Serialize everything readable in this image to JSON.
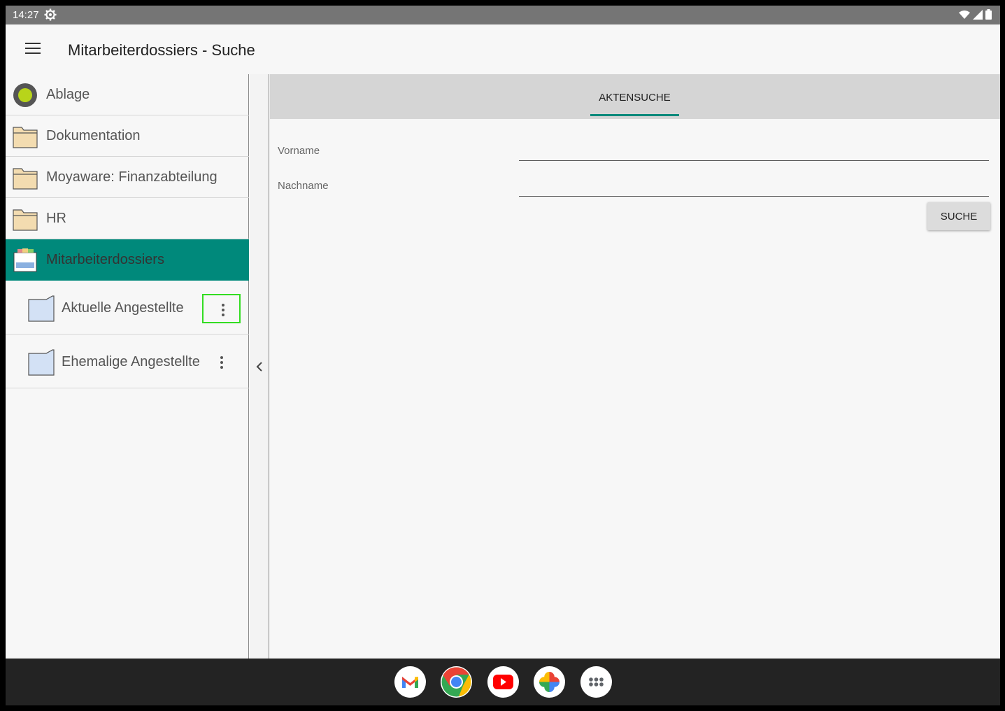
{
  "status_bar": {
    "time": "14:27",
    "icons": [
      "settings-icon",
      "wifi-icon",
      "signal-icon",
      "battery-icon"
    ]
  },
  "app_bar": {
    "title": "Mitarbeiterdossiers - Suche",
    "menu_icon": "menu-icon"
  },
  "nav": {
    "items": [
      {
        "label": "Ablage",
        "icon": "storage-circle-icon"
      },
      {
        "label": "Dokumentation",
        "icon": "folder-icon"
      },
      {
        "label": "Moyaware: Finanzabteilung",
        "icon": "folder-icon"
      },
      {
        "label": "HR",
        "icon": "folder-icon"
      },
      {
        "label": "Mitarbeiterdossiers",
        "icon": "dossier-box-icon",
        "selected": true
      }
    ],
    "sub_items": [
      {
        "label": "Aktuelle Angestellte",
        "icon": "blue-folder-icon",
        "menu_icon": "more-vert-icon",
        "highlighted": true
      },
      {
        "label": "Ehemalige Angestellte",
        "icon": "blue-folder-icon",
        "menu_icon": "more-vert-icon"
      }
    ]
  },
  "search": {
    "tab_label": "AKTENSUCHE",
    "fields": [
      {
        "label": "Vorname",
        "value": ""
      },
      {
        "label": "Nachname",
        "value": ""
      }
    ],
    "button_label": "SUCHE"
  },
  "dock": {
    "apps": [
      "gmail-icon",
      "chrome-icon",
      "youtube-icon",
      "photos-icon",
      "app-drawer-icon"
    ]
  },
  "colors": {
    "accent": "#00897b",
    "highlight_border": "#33dd22",
    "status_bar": "#757575",
    "taskbar": "#232323",
    "folder_fill": "#f3dcb0",
    "blue_folder_fill": "#d3e1f5"
  }
}
